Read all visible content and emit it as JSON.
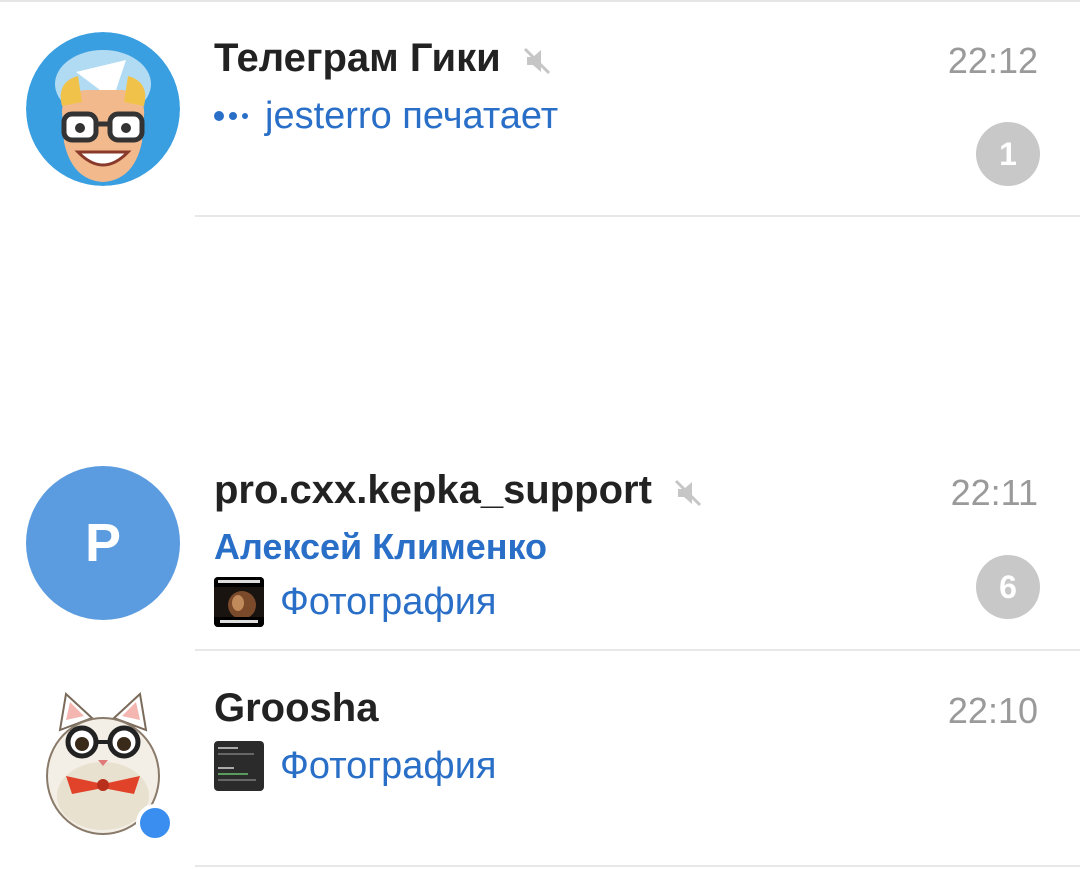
{
  "chats": [
    {
      "title": "Телеграм Гики",
      "muted": true,
      "time": "22:12",
      "preview": "jesterro печатает",
      "unread": "1",
      "avatar_icon": "geek-cartoon-avatar-icon"
    },
    {
      "title": "pro.cxx.kepka_support",
      "muted": true,
      "time": "22:11",
      "sender": "Алексей Клименко",
      "preview": "Фотография",
      "unread": "6",
      "avatar_letter": "P",
      "avatar_color": "#5b9be0"
    },
    {
      "title": "Groosha",
      "muted": false,
      "time": "22:10",
      "preview": "Фотография",
      "online": true,
      "avatar_icon": "cat-with-glasses-avatar-icon"
    }
  ],
  "colors": {
    "accent": "#2a6fc7",
    "badge_muted": "#c8c8c8",
    "online": "#3a8ef0",
    "time": "#9a9a9a"
  }
}
